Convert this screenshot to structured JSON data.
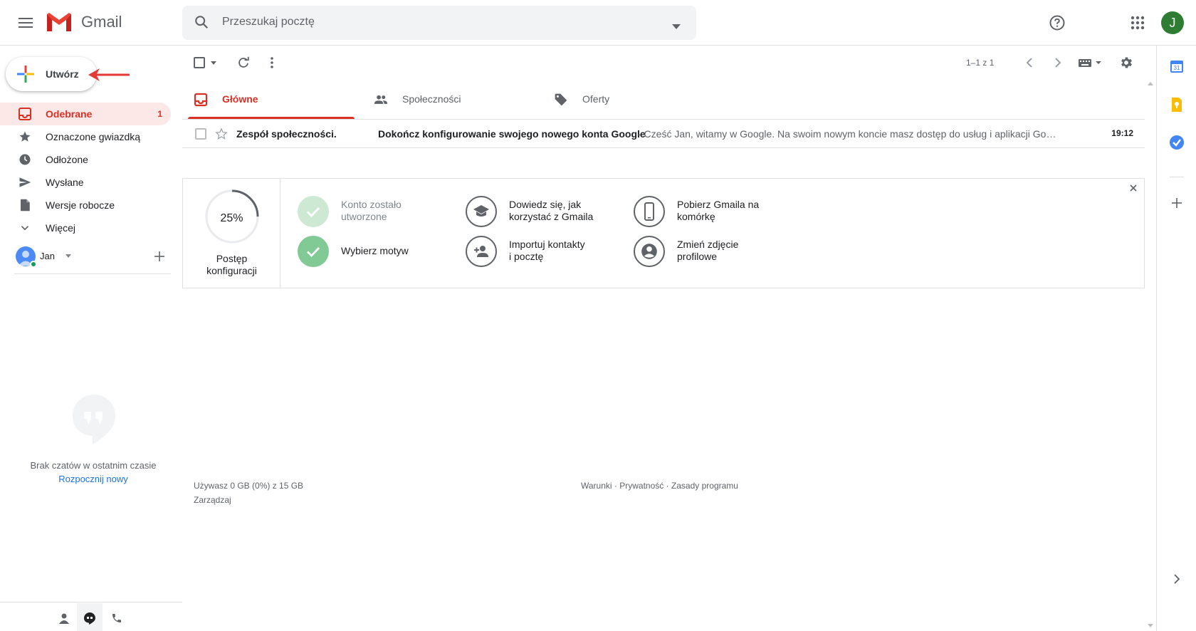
{
  "app": {
    "name": "Gmail"
  },
  "search": {
    "placeholder": "Przeszukaj pocztę"
  },
  "compose": {
    "label": "Utwórz"
  },
  "nav": {
    "items": [
      {
        "label": "Odebrane",
        "count": "1",
        "icon": "inbox-icon"
      },
      {
        "label": "Oznaczone gwiazdką",
        "count": "",
        "icon": "star-icon"
      },
      {
        "label": "Odłożone",
        "count": "",
        "icon": "clock-icon"
      },
      {
        "label": "Wysłane",
        "count": "",
        "icon": "send-icon"
      },
      {
        "label": "Wersje robocze",
        "count": "",
        "icon": "draft-icon"
      },
      {
        "label": "Więcej",
        "count": "",
        "icon": "chevron-down-icon"
      }
    ]
  },
  "user": {
    "name": "Jan",
    "initial": "J"
  },
  "chat": {
    "empty_text": "Brak czatów w ostatnim czasie",
    "start_link": "Rozpocznij nowy"
  },
  "toolbar": {
    "pager": "1–1 z 1"
  },
  "tabs": [
    {
      "label": "Główne",
      "icon": "inbox-icon"
    },
    {
      "label": "Społeczności",
      "icon": "people-icon"
    },
    {
      "label": "Oferty",
      "icon": "tag-icon"
    }
  ],
  "emails": [
    {
      "sender": "Zespół społeczności.",
      "subject": "Dokończ konfigurowanie swojego nowego konta Google",
      "snippet": " - Cześć Jan, witamy w Google. Na swoim nowym koncie masz dostęp do usług i aplikacji Go…",
      "time": "19:12"
    }
  ],
  "setup": {
    "progress_value": 0.25,
    "progress_text": "25%",
    "progress_label_1": "Postęp",
    "progress_label_2": "konfiguracji",
    "steps": [
      {
        "line1": "Konto zostało",
        "line2": "utworzone",
        "state": "done-light",
        "icon": "check-icon"
      },
      {
        "line1": "Wybierz motyw",
        "line2": "",
        "state": "done",
        "icon": "check-icon"
      },
      {
        "line1": "Dowiedz się, jak",
        "line2": "korzystać z Gmaila",
        "state": "todo",
        "icon": "graduation-cap-icon"
      },
      {
        "line1": "Importuj kontakty",
        "line2": "i pocztę",
        "state": "todo",
        "icon": "add-person-icon"
      },
      {
        "line1": "Pobierz Gmaila na",
        "line2": "komórkę",
        "state": "todo",
        "icon": "phone-icon"
      },
      {
        "line1": "Zmień zdjęcie",
        "line2": "profilowe",
        "state": "todo",
        "icon": "account-circle-icon"
      }
    ]
  },
  "footer": {
    "storage": "Używasz 0 GB (0%) z 15 GB",
    "manage": "Zarządzaj",
    "links": "Warunki · Prywatność · Zasady programu"
  },
  "colors": {
    "accent_red": "#d93025",
    "active_bg": "#fce8e6",
    "link_blue": "#1a73e8",
    "avatar_green": "#2e7d32"
  }
}
